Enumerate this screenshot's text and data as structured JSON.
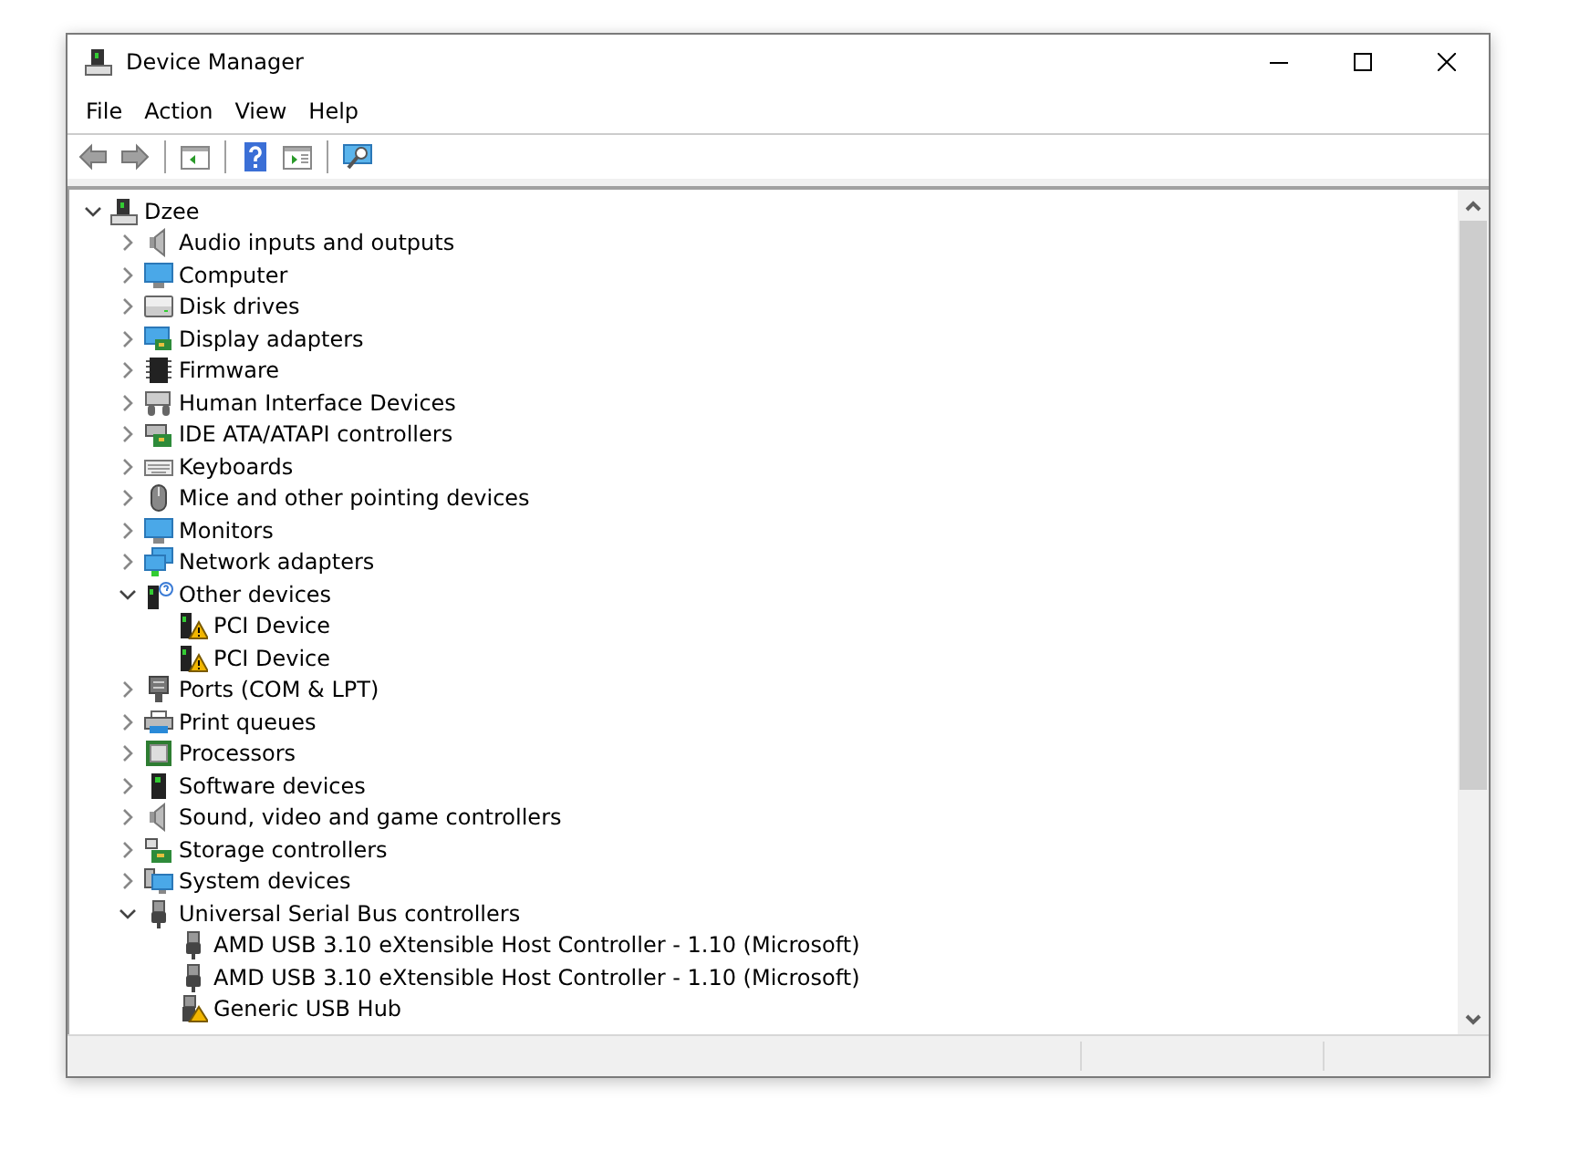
{
  "window": {
    "title": "Device Manager"
  },
  "menu": [
    "File",
    "Action",
    "View",
    "Help"
  ],
  "toolbar": [
    {
      "kind": "back",
      "disabled": true
    },
    {
      "kind": "forward",
      "disabled": true
    },
    {
      "kind": "sep"
    },
    {
      "kind": "console"
    },
    {
      "kind": "sep"
    },
    {
      "kind": "help"
    },
    {
      "kind": "pane"
    },
    {
      "kind": "sep"
    },
    {
      "kind": "scan"
    }
  ],
  "tree": [
    {
      "label": "Dzee",
      "kind": "computer-tower",
      "expanded": true,
      "children": [
        {
          "label": "Audio inputs and outputs",
          "kind": "speaker",
          "expanded": false
        },
        {
          "label": "Computer",
          "kind": "monitor",
          "expanded": false
        },
        {
          "label": "Disk drives",
          "kind": "disk",
          "expanded": false
        },
        {
          "label": "Display adapters",
          "kind": "display-card",
          "expanded": false
        },
        {
          "label": "Firmware",
          "kind": "chip",
          "expanded": false
        },
        {
          "label": "Human Interface Devices",
          "kind": "hid",
          "expanded": false
        },
        {
          "label": "IDE ATA/ATAPI controllers",
          "kind": "card",
          "expanded": false
        },
        {
          "label": "Keyboards",
          "kind": "keyboard",
          "expanded": false
        },
        {
          "label": "Mice and other pointing devices",
          "kind": "mouse",
          "expanded": false
        },
        {
          "label": "Monitors",
          "kind": "monitor",
          "expanded": false
        },
        {
          "label": "Network adapters",
          "kind": "network",
          "expanded": false
        },
        {
          "label": "Other devices",
          "kind": "unknown",
          "expanded": true,
          "children": [
            {
              "label": "PCI Device",
              "kind": "warning"
            },
            {
              "label": "PCI Device",
              "kind": "warning"
            }
          ]
        },
        {
          "label": "Ports (COM & LPT)",
          "kind": "port",
          "expanded": false
        },
        {
          "label": "Print queues",
          "kind": "printer",
          "expanded": false
        },
        {
          "label": "Processors",
          "kind": "cpu",
          "expanded": false
        },
        {
          "label": "Software devices",
          "kind": "tower",
          "expanded": false
        },
        {
          "label": "Sound, video and game controllers",
          "kind": "speaker",
          "expanded": false
        },
        {
          "label": "Storage controllers",
          "kind": "storage",
          "expanded": false
        },
        {
          "label": "System devices",
          "kind": "system",
          "expanded": false
        },
        {
          "label": "Universal Serial Bus controllers",
          "kind": "usb",
          "expanded": true,
          "children": [
            {
              "label": "AMD USB 3.10 eXtensible Host Controller - 1.10 (Microsoft)",
              "kind": "usb"
            },
            {
              "label": "AMD USB 3.10 eXtensible Host Controller - 1.10 (Microsoft)",
              "kind": "usb"
            },
            {
              "label": "Generic USB Hub",
              "kind": "usb-warning"
            }
          ]
        }
      ]
    }
  ]
}
